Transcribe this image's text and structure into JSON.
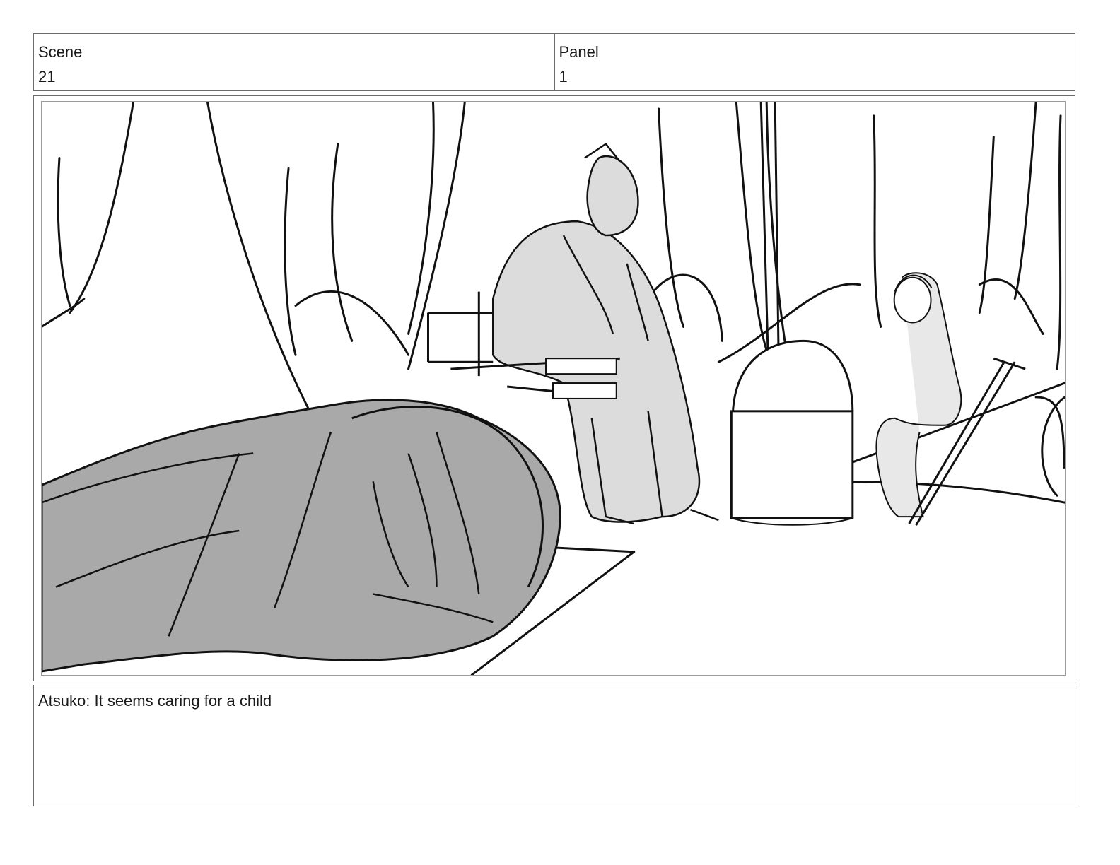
{
  "header": {
    "scene_label": "Scene",
    "scene_value": "21",
    "panel_label": "Panel",
    "panel_value": "1"
  },
  "panel_image": {
    "kind": "storyboard sketch",
    "fill_colors": {
      "dark_shade": "#a9a9a9",
      "light_shade": "#dcdcdc",
      "line": "#111111"
    }
  },
  "notes": {
    "dialogue": "Atsuko: It seems caring for a child"
  }
}
